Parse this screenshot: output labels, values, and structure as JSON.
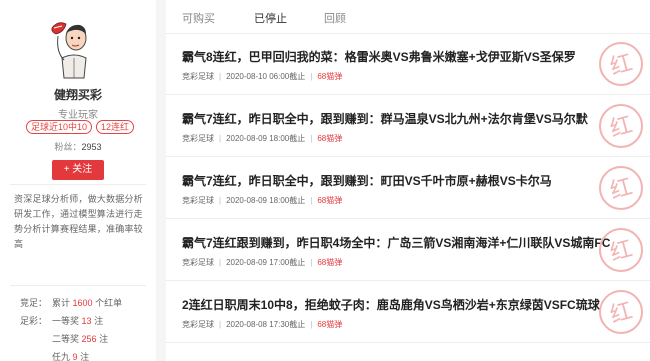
{
  "profile": {
    "name": "健翔买彩",
    "title": "专业玩家",
    "badges": [
      "足球近10中10",
      "12连红"
    ],
    "fans_label": "粉丝：",
    "fans_count": "2953",
    "follow_label": "+ 关注",
    "intro": "资深足球分析师，做大数据分析研发工作，通过模型算法进行走势分析计算赛程结果，准确率较高"
  },
  "stats": {
    "jingzu_label": "竞足：",
    "jingzu_prefix": "累计",
    "jingzu_count": "1600",
    "jingzu_suffix": "个红单",
    "zucai_label": "足彩：",
    "first_prize_label": "一等奖",
    "first_prize_count": "13",
    "second_prize_label": "二等奖",
    "second_prize_count": "256",
    "renjiu_label": "任九",
    "renjiu_count": "9",
    "unit": "注"
  },
  "tabs": [
    "可购买",
    "已停止",
    "回顾"
  ],
  "active_tab": "已停止",
  "articles": [
    {
      "title": "霸气8连红，巴甲回归我的菜：格雷米奥VS弗鲁米嫩塞+戈伊亚斯VS圣保罗",
      "category": "竞彩足球",
      "time": "2020-08-10 06:00截止",
      "price": "68猫弹"
    },
    {
      "title": "霸气7连红，昨日职全中，跟到赚到：群马温泉VS北九州+法尔肯堡VS马尔默",
      "category": "竞彩足球",
      "time": "2020-08-09 18:00截止",
      "price": "68猫弹"
    },
    {
      "title": "霸气7连红，昨日职全中，跟到赚到：町田VS千叶市原+赫根VS卡尔马",
      "category": "竞彩足球",
      "time": "2020-08-09 18:00截止",
      "price": "68猫弹"
    },
    {
      "title": "霸气7连红跟到赚到，昨日职4场全中：广岛三箭VS湘南海洋+仁川联队VS城南FC",
      "category": "竞彩足球",
      "time": "2020-08-09 17:00截止",
      "price": "68猫弹"
    },
    {
      "title": "2连红日职周末10中8，拒绝蚊子肉：鹿岛鹿角VS鸟栖沙岩+东京绿茵VSFC琉球",
      "category": "竞彩足球",
      "time": "2020-08-08 17:30截止",
      "price": "68猫弹"
    }
  ],
  "stamp_text": "红",
  "colors": {
    "accent": "#e4393c",
    "stamp": "#f2b3b3"
  }
}
